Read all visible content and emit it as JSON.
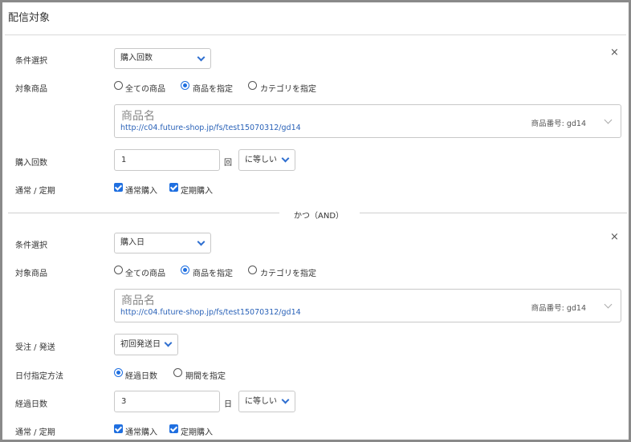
{
  "title": "配信対象",
  "close_glyph": "×",
  "blocks": [
    {
      "condition_label": "条件選択",
      "condition_value": "購入回数",
      "target_label": "対象商品",
      "radios": [
        "全ての商品",
        "商品を指定",
        "カテゴリを指定"
      ],
      "product_name": "商品名",
      "product_url": "http://c04.future-shop.jp/fs/test15070312/gd14",
      "product_number": "商品番号: gd14",
      "count_label": "購入回数",
      "count_value": "1",
      "count_unit": "回",
      "compare_value": "に等しい",
      "type_label": "通常 / 定期",
      "check_normal": "通常購入",
      "check_subscription": "定期購入"
    },
    {
      "condition_label": "条件選択",
      "condition_value": "購入日",
      "target_label": "対象商品",
      "radios": [
        "全ての商品",
        "商品を指定",
        "カテゴリを指定"
      ],
      "product_name": "商品名",
      "product_url": "http://c04.future-shop.jp/fs/test15070312/gd14",
      "product_number": "商品番号: gd14",
      "order_label": "受注 / 発送",
      "order_value": "初回発送日",
      "date_method_label": "日付指定方法",
      "date_radios": [
        "経過日数",
        "期間を指定"
      ],
      "elapsed_label": "経過日数",
      "elapsed_value": "3",
      "elapsed_unit": "日",
      "compare_value": "に等しい",
      "type_label": "通常 / 定期",
      "check_normal": "通常購入",
      "check_subscription": "定期購入"
    }
  ],
  "and_label": "かつ（AND）"
}
